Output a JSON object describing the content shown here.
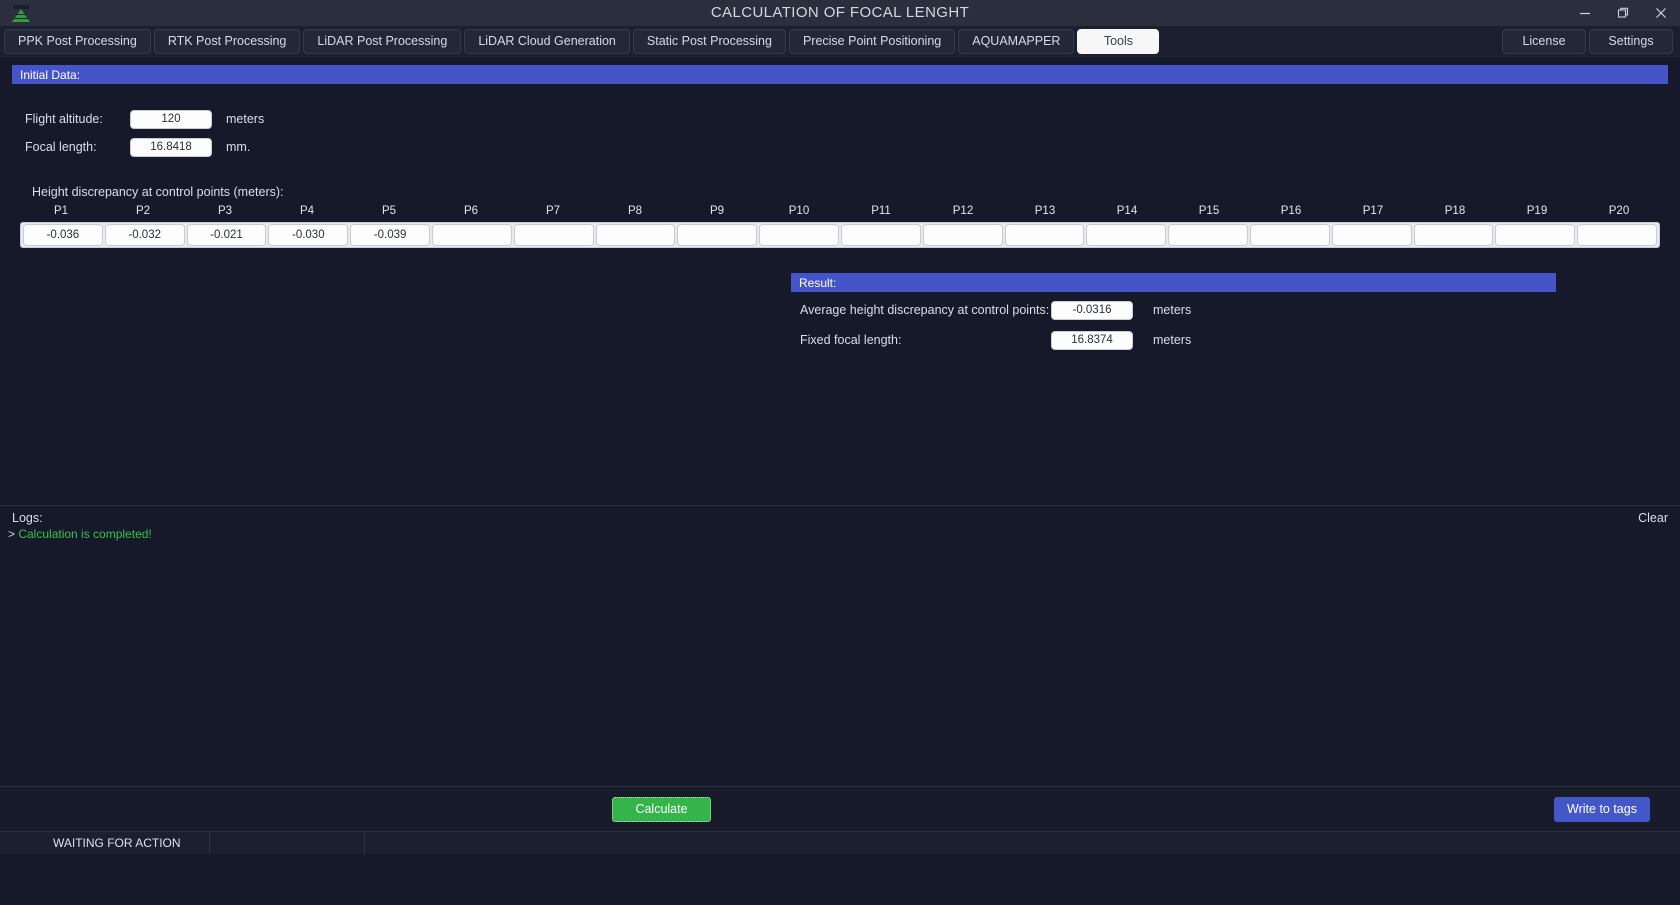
{
  "window": {
    "title": "CALCULATION OF FOCAL LENGHT",
    "icon": "drone-logo-icon",
    "controls": {
      "minimize": "minimize-icon",
      "maximize": "maximize-icon",
      "close": "close-icon"
    }
  },
  "tabs": [
    {
      "label": "PPK Post Processing",
      "active": false
    },
    {
      "label": "RTK Post Processing",
      "active": false
    },
    {
      "label": "LiDAR Post Processing",
      "active": false
    },
    {
      "label": "LiDAR Cloud Generation",
      "active": false
    },
    {
      "label": "Static Post Processing",
      "active": false
    },
    {
      "label": "Precise Point Positioning",
      "active": false
    },
    {
      "label": "AQUAMAPPER",
      "active": false
    },
    {
      "label": "Tools",
      "active": true
    }
  ],
  "tabs_right": [
    {
      "label": "License"
    },
    {
      "label": "Settings"
    }
  ],
  "initial_data": {
    "header": "Initial Data:",
    "flight_altitude": {
      "label": "Flight altitude:",
      "value": "120",
      "unit": "meters"
    },
    "focal_length": {
      "label": "Focal length:",
      "value": "16.8418",
      "unit": "mm."
    },
    "control_points": {
      "caption": "Height discrepancy at control points (meters):",
      "headers": [
        "P1",
        "P2",
        "P3",
        "P4",
        "P5",
        "P6",
        "P7",
        "P8",
        "P9",
        "P10",
        "P11",
        "P12",
        "P13",
        "P14",
        "P15",
        "P16",
        "P17",
        "P18",
        "P19",
        "P20"
      ],
      "values": [
        "-0.036",
        "-0.032",
        "-0.021",
        "-0.030",
        "-0.039",
        "",
        "",
        "",
        "",
        "",
        "",
        "",
        "",
        "",
        "",
        "",
        "",
        "",
        "",
        ""
      ]
    }
  },
  "result": {
    "header": "Result:",
    "rows": [
      {
        "label": "Average height discrepancy at control points:",
        "value": "-0.0316",
        "unit": "meters"
      },
      {
        "label": "Fixed focal length:",
        "value": "16.8374",
        "unit": "meters"
      }
    ]
  },
  "logs": {
    "title": "Logs:",
    "clear_label": "Clear",
    "entries": [
      {
        "prefix": "> ",
        "message": "Calculation is completed!"
      }
    ]
  },
  "footer": {
    "calculate_label": "Calculate",
    "write_to_tags_label": "Write to tags"
  },
  "statusbar": {
    "status": "WAITING FOR ACTION",
    "secondary": ""
  },
  "colors": {
    "accent_blue": "#4555c7",
    "success_green": "#35b44a",
    "log_green": "#35c44a",
    "background": "#151929",
    "titlebar": "#2b2f3d"
  }
}
